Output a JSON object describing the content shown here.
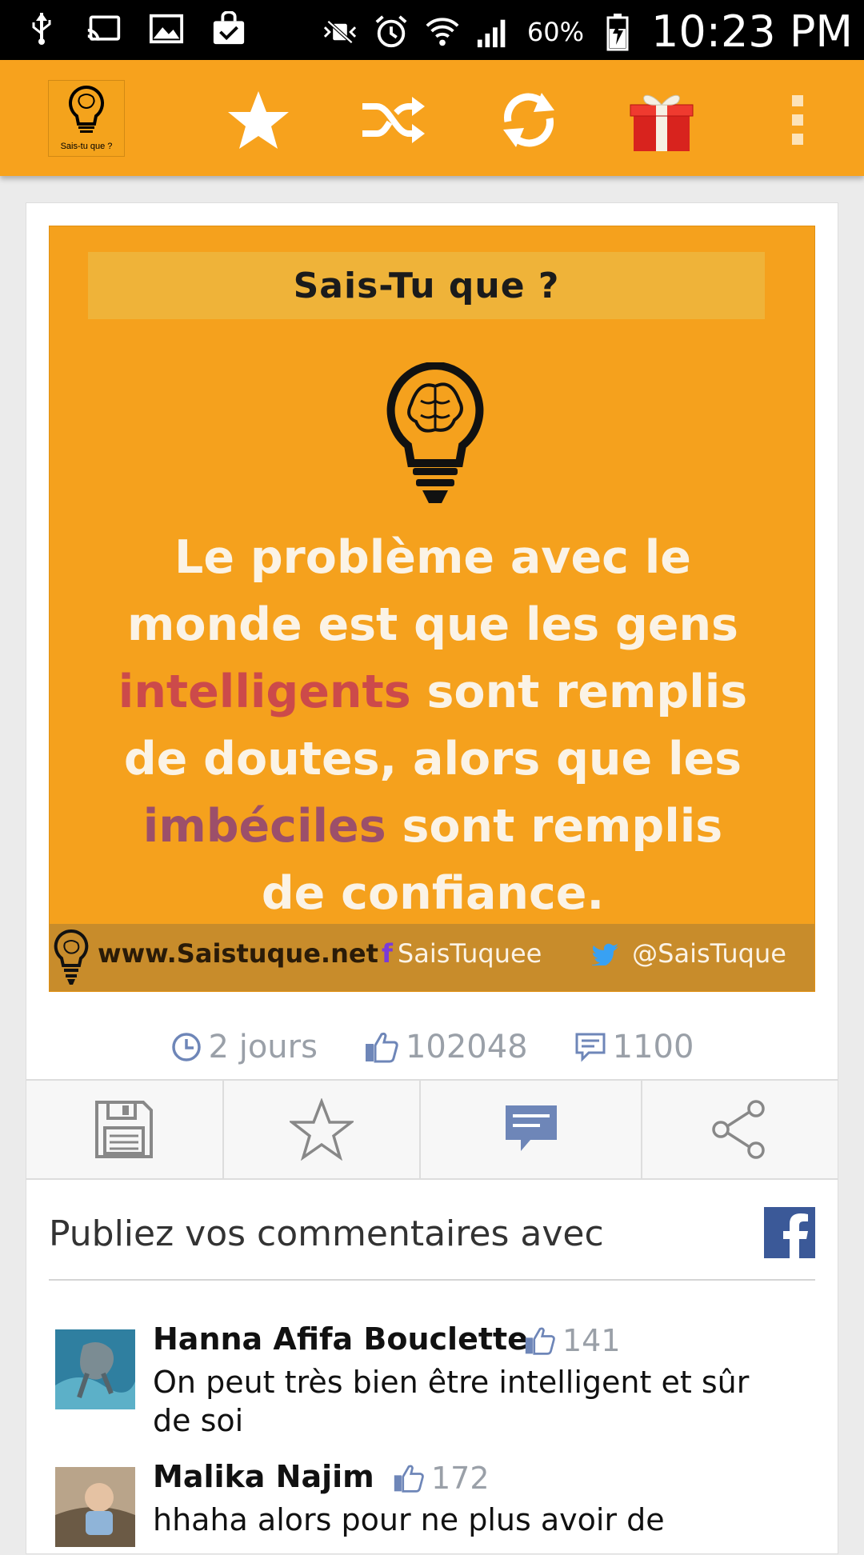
{
  "status_bar": {
    "battery": "60%",
    "time": "10:23 PM",
    "icons_left": [
      "usb-icon",
      "cast-icon",
      "image-icon",
      "bag-check-icon"
    ],
    "icons_right": [
      "mute-icon",
      "alarm-icon",
      "wifi-icon",
      "signal-icon",
      "battery-icon"
    ]
  },
  "app_bar": {
    "logo_caption": "Sais-tu que ?",
    "actions": [
      "star-icon",
      "shuffle-icon",
      "refresh-icon",
      "gift-icon",
      "more-icon"
    ],
    "accent": "#f7a21d"
  },
  "post": {
    "poster": {
      "title": "Sais-Tu que ?",
      "quote_line1": "Le problème avec le",
      "quote_line2": "monde est que les gens",
      "quote_hl1": "intelligents",
      "quote_line3_rest": " sont remplis",
      "quote_line4": "de doutes, alors que les",
      "quote_hl2": "imbéciles",
      "quote_line5_rest": " sont remplis",
      "quote_line6": "de confiance.",
      "footer_site": "www.Saistuque.net",
      "footer_fb": "SaisTuquee",
      "footer_tw": "@SaisTuque"
    },
    "time_ago": "2 jours",
    "likes": "102048",
    "comments": "1100"
  },
  "actions": [
    "save-icon",
    "favorite-star-icon",
    "comment-icon",
    "share-icon"
  ],
  "comments_section": {
    "heading": "Publiez vos commentaires avec",
    "items": [
      {
        "name": "Hanna Afifa Bouclette",
        "likes": "141",
        "text": "On peut très bien être intelligent et sûr de soi"
      },
      {
        "name": "Malika Najim",
        "likes": "172",
        "text": "hhaha alors pour ne plus avoir de"
      }
    ]
  }
}
